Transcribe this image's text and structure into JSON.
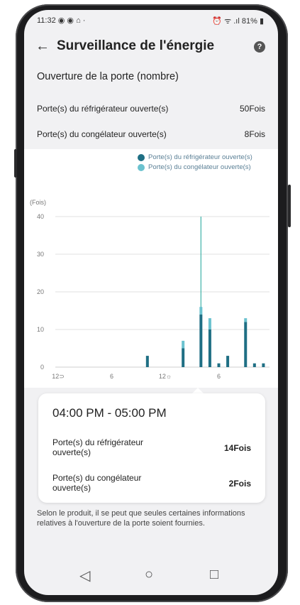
{
  "status_bar": {
    "time": "11:32",
    "left_icons": "◉ ◉ ⌂ ·",
    "right_icons": "⏰ ᯤ .ıl",
    "battery": "81%"
  },
  "header": {
    "title": "Surveillance de l'énergie",
    "back_icon": "arrow-left-icon",
    "help_icon": "question-icon"
  },
  "section": {
    "title": "Ouverture de la porte (nombre)"
  },
  "summary": [
    {
      "label": "Porte(s) du réfrigérateur ouverte(s)",
      "value": "50Fois"
    },
    {
      "label": "Porte(s) du congélateur ouverte(s)",
      "value": "8Fois"
    }
  ],
  "chart_data": {
    "type": "bar",
    "legend": [
      {
        "name": "Porte(s) du réfrigérateur ouverte(s)",
        "color": "#1f6f84"
      },
      {
        "name": "Porte(s) du congélateur ouverte(s)",
        "color": "#6bc2cf"
      }
    ],
    "ylabel": "(Fois)",
    "yticks": [
      0,
      10,
      20,
      30,
      40
    ],
    "ylim": [
      0,
      40
    ],
    "xticks": [
      {
        "hour": 0,
        "label": "12⊃"
      },
      {
        "hour": 6,
        "label": "6"
      },
      {
        "hour": 12,
        "label": "12☼"
      },
      {
        "hour": 18,
        "label": "6"
      }
    ],
    "xlim": [
      0,
      24
    ],
    "series": [
      {
        "name": "Porte(s) du réfrigérateur ouverte(s)",
        "points": [
          {
            "hour": 10,
            "value": 3
          },
          {
            "hour": 14,
            "value": 5
          },
          {
            "hour": 16,
            "value": 14
          },
          {
            "hour": 17,
            "value": 10
          },
          {
            "hour": 18,
            "value": 1
          },
          {
            "hour": 19,
            "value": 3
          },
          {
            "hour": 21,
            "value": 12
          },
          {
            "hour": 22,
            "value": 1
          },
          {
            "hour": 23,
            "value": 1
          }
        ]
      },
      {
        "name": "Porte(s) du congélateur ouverte(s)",
        "points": [
          {
            "hour": 14,
            "value": 2
          },
          {
            "hour": 16,
            "value": 2
          },
          {
            "hour": 17,
            "value": 3
          },
          {
            "hour": 21,
            "value": 1
          }
        ]
      }
    ],
    "highlight": {
      "hour": 16,
      "value": 40
    }
  },
  "tooltip": {
    "time_range": "04:00 PM - 05:00 PM",
    "rows": [
      {
        "label": "Porte(s) du réfrigérateur ouverte(s)",
        "value": "14Fois"
      },
      {
        "label": "Porte(s) du congélateur ouverte(s)",
        "value": "2Fois"
      }
    ]
  },
  "note": "Selon le produit, il se peut que seules certaines informations relatives à l'ouverture de la porte soient fournies.",
  "nav_bar": {
    "back": "◁",
    "home": "○",
    "recent": "□"
  }
}
